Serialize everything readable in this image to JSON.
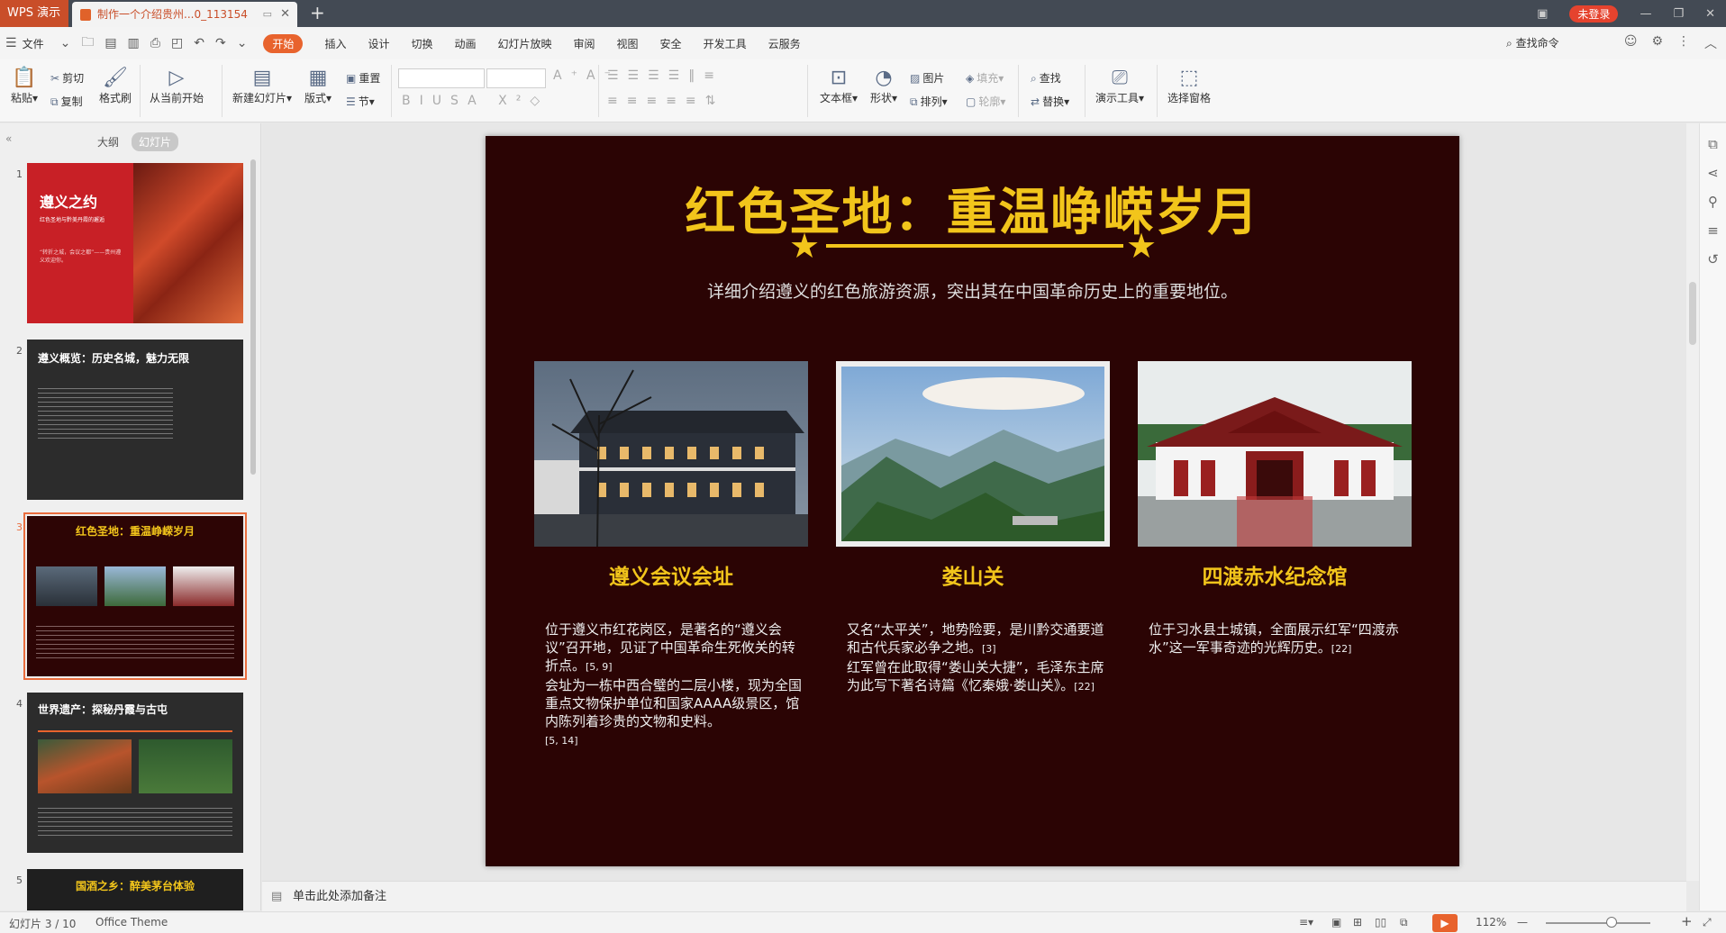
{
  "titlebar": {
    "app_name": "WPS 演示",
    "doc_tab": "制作一个介绍贵州...0_113154",
    "login": "未登录"
  },
  "menu": {
    "file": "文件",
    "tabs": [
      "开始",
      "插入",
      "设计",
      "切换",
      "动画",
      "幻灯片放映",
      "审阅",
      "视图",
      "安全",
      "开发工具",
      "云服务"
    ],
    "search_cmd": "查找命令"
  },
  "ribbon": {
    "paste": "粘贴",
    "cut": "剪切",
    "copy": "复制",
    "format_painter": "格式刷",
    "from_current": "从当前开始",
    "new_slide": "新建幻灯片",
    "layout": "版式",
    "reset": "重置",
    "section": "节",
    "textbox": "文本框",
    "shape": "形状",
    "picture": "图片",
    "arrange": "排列",
    "fill": "填充",
    "outline": "轮廓",
    "find": "查找",
    "replace": "替换",
    "present_tools": "演示工具",
    "select_pane": "选择窗格"
  },
  "left_pane": {
    "tab_outline": "大纲",
    "tab_slides": "幻灯片",
    "thumbs": [
      {
        "num": "1",
        "title": "遵义之约",
        "sub": "红色圣地与黔美丹霞的邂逅",
        "body": "“转折之城，会议之都”——贵州遵义欢迎你。"
      },
      {
        "num": "2",
        "title": "遵义概览：历史名城，魅力无限"
      },
      {
        "num": "3",
        "title": "红色圣地：重温峥嵘岁月"
      },
      {
        "num": "4",
        "title": "世界遗产：探秘丹霞与古屯"
      },
      {
        "num": "5",
        "title": "国酒之乡：醉美茅台体验"
      }
    ]
  },
  "slide": {
    "title": "红色圣地：重温峥嵘岁月",
    "subtitle": "详细介绍遵义的红色旅游资源，突出其在中国革命历史上的重要地位。",
    "cards": [
      {
        "title": "遵义会议会址",
        "body1": "位于遵义市红花岗区，是著名的“遵义会议”召开地，见证了中国革命生死攸关的转折点。",
        "ref1": "[5, 9]",
        "body2": "会址为一栋中西合璧的二层小楼，现为全国重点文物保护单位和国家AAAA级景区，馆内陈列着珍贵的文物和史料。",
        "ref2": "[5, 14]"
      },
      {
        "title": "娄山关",
        "body1": "又名“太平关”，地势险要，是川黔交通要道和古代兵家必争之地。",
        "ref1": "[3]",
        "body2": "红军曾在此取得“娄山关大捷”，毛泽东主席为此写下著名诗篇《忆秦娥·娄山关》。",
        "ref2": "[22]"
      },
      {
        "title": "四渡赤水纪念馆",
        "body1": "位于习水县土城镇，全面展示红军“四渡赤水”这一军事奇迹的光辉历史。",
        "ref1": "[22]"
      }
    ]
  },
  "notes_placeholder": "单击此处添加备注",
  "status": {
    "slide_count": "幻灯片 3 / 10",
    "theme": "Office Theme",
    "zoom": "112%"
  },
  "colors": {
    "accent": "#e8632d",
    "slide_bg": "#2b0404",
    "gold": "#f2c51b"
  }
}
